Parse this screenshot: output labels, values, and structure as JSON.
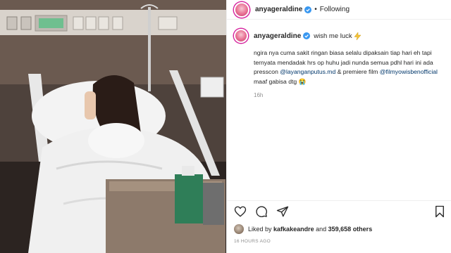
{
  "post": {
    "photo_description": "hospital-bed-photo",
    "header": {
      "username": "anyageraldine",
      "separator": "•",
      "follow_status": "Following"
    },
    "caption": {
      "username": "anyageraldine",
      "title": "wish me luck",
      "body_part1": "ngira nya cuma sakit ringan biasa selalu dipaksain tiap hari eh tapi ternyata mendadak hrs op huhu jadi nunda semua pdhl hari ini ada presscon ",
      "mention1": "@layanganputus.md",
      "body_part2": " & premiere film ",
      "mention2": "@filmyowisbenofficial",
      "body_part3": " maaf gabisa dtg 😭",
      "time": "16h"
    },
    "actions": {
      "like_icon": "heart-icon",
      "comment_icon": "comment-icon",
      "share_icon": "share-icon",
      "save_icon": "bookmark-icon"
    },
    "likes": {
      "prefix": "Liked by",
      "user": "kafkakeandre",
      "conjunction": "and",
      "count": "359,658 others"
    },
    "posted_ago": "16 HOURS AGO"
  },
  "colors": {
    "text": "#262626",
    "secondary": "#8e8e8e",
    "mention": "#00376b",
    "verified": "#3897f0"
  }
}
